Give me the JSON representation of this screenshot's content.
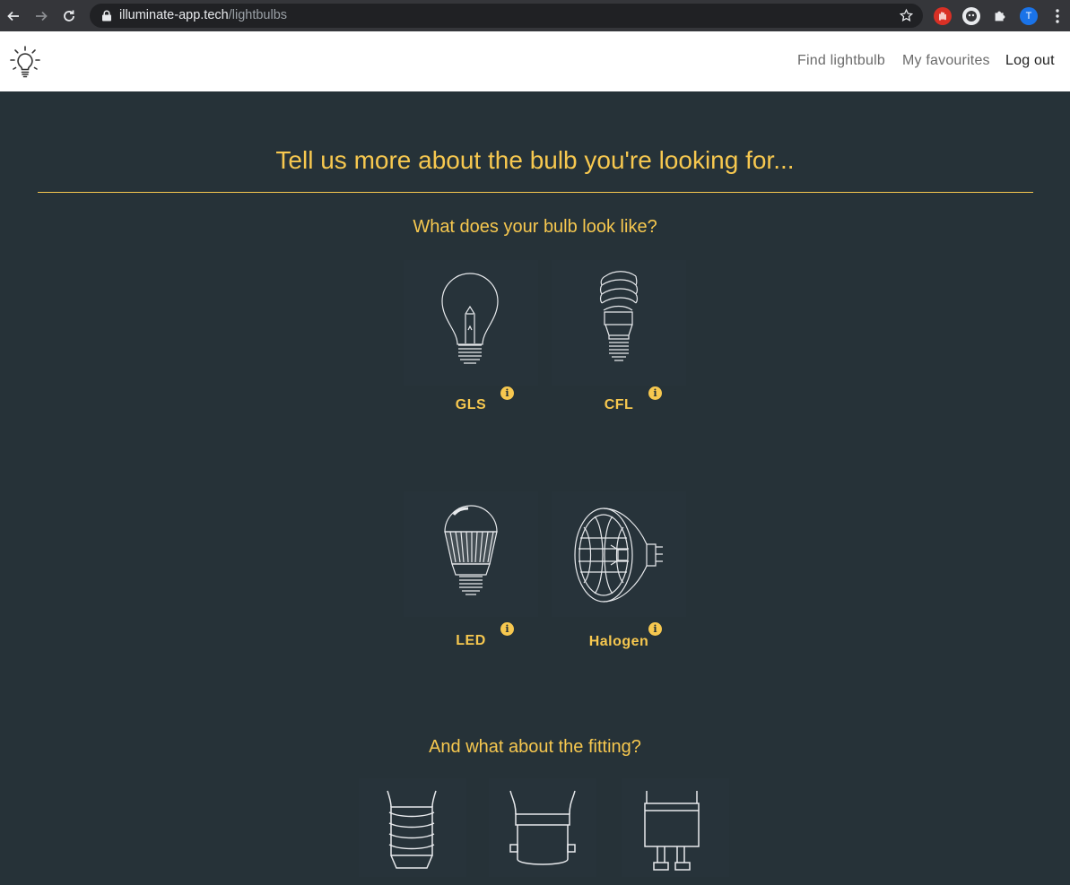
{
  "browser": {
    "url_host": "illuminate-app.tech",
    "url_path": "/lightbulbs",
    "profile_initial": "T"
  },
  "header": {
    "logo_icon": "lightbulb-icon",
    "nav": {
      "find": "Find lightbulb",
      "favourites": "My favourites",
      "logout": "Log out"
    }
  },
  "main": {
    "title": "Tell us more about the bulb you're looking for...",
    "shape_question": "What does your bulb look like?",
    "shapes": [
      {
        "label": "GLS",
        "icon": "gls-bulb-icon"
      },
      {
        "label": "CFL",
        "icon": "cfl-bulb-icon"
      },
      {
        "label": "LED",
        "icon": "led-bulb-icon"
      },
      {
        "label": "Halogen",
        "icon": "halogen-bulb-icon"
      }
    ],
    "fitting_question": "And what about the fitting?",
    "fittings": [
      {
        "icon": "screw-fitting-icon"
      },
      {
        "icon": "bayonet-fitting-icon"
      },
      {
        "icon": "pin-fitting-icon"
      }
    ]
  },
  "colors": {
    "background": "#263238",
    "accent": "#f7c84f",
    "header": "#ffffff"
  }
}
